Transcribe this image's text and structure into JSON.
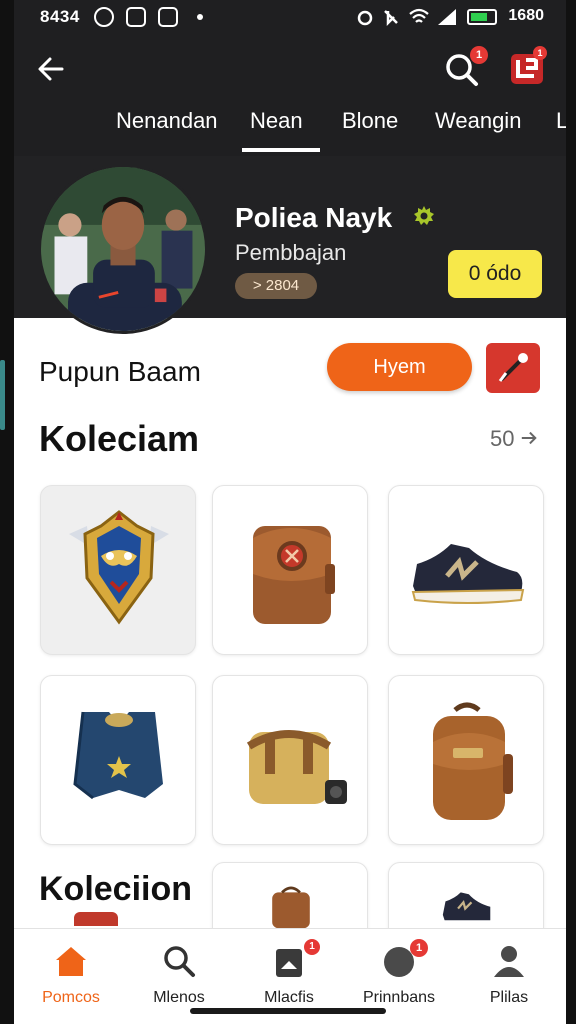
{
  "status_bar": {
    "time": "8434",
    "right_text": "1680"
  },
  "header": {
    "search_badge": "1",
    "app_badge": "1"
  },
  "tabs": [
    "Nenandan",
    "Nean",
    "Blone",
    "Weangin",
    "L"
  ],
  "active_tab": "Nean",
  "profile": {
    "name": "Poliea Nayk",
    "subtitle": "Pembbajan",
    "pill": "> 2804",
    "action_label": "0 ódo"
  },
  "row": {
    "title": "Pupun Baam",
    "primary_button": "Hyem"
  },
  "collection": {
    "title": "Koleciam",
    "count": "50",
    "items": [
      {
        "icon": "mask-emblem-icon"
      },
      {
        "icon": "leather-pouch-icon"
      },
      {
        "icon": "sneaker-icon"
      },
      {
        "icon": "blue-vest-icon"
      },
      {
        "icon": "camera-bag-icon"
      },
      {
        "icon": "backpack-icon"
      }
    ]
  },
  "collection2": {
    "title": "Koleciion"
  },
  "bottom_nav": [
    {
      "label": "Pomcos",
      "icon": "home-icon",
      "active": true
    },
    {
      "label": "Mlenos",
      "icon": "search-icon",
      "active": false
    },
    {
      "label": "Mlacfis",
      "icon": "bag-icon",
      "active": false,
      "badge": "1"
    },
    {
      "label": "Prinnbans",
      "icon": "circle-icon",
      "active": false,
      "badge": "1"
    },
    {
      "label": "Plilas",
      "icon": "user-icon",
      "active": false
    }
  ],
  "colors": {
    "accent": "#ef6418",
    "header_bg": "#1f1f21",
    "yellow": "#f7e84a",
    "badge": "#e53935"
  }
}
